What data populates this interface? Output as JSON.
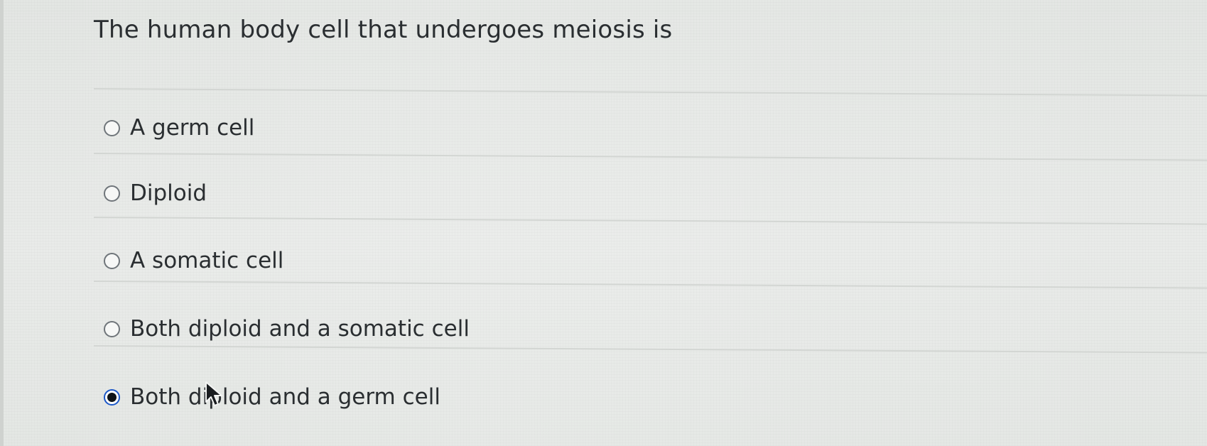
{
  "question": {
    "text": "The human body cell that undergoes meiosis is"
  },
  "options": [
    {
      "label": "A germ cell",
      "selected": false
    },
    {
      "label": "Diploid",
      "selected": false
    },
    {
      "label": "A somatic cell",
      "selected": false
    },
    {
      "label": "Both diploid and a somatic cell",
      "selected": false
    },
    {
      "label": "Both diploid and a germ cell",
      "selected": true
    }
  ],
  "icons": {
    "radio_unselected": "radio-empty-icon",
    "radio_selected": "radio-filled-icon",
    "cursor": "mouse-pointer-icon"
  },
  "colors": {
    "text": "#2a2e31",
    "radio_border": "#6f757a",
    "radio_selected_ring": "#1c58c8",
    "radio_selected_dot": "#101418",
    "background": "#e6e8e6",
    "divider": "#d3d6d3"
  }
}
